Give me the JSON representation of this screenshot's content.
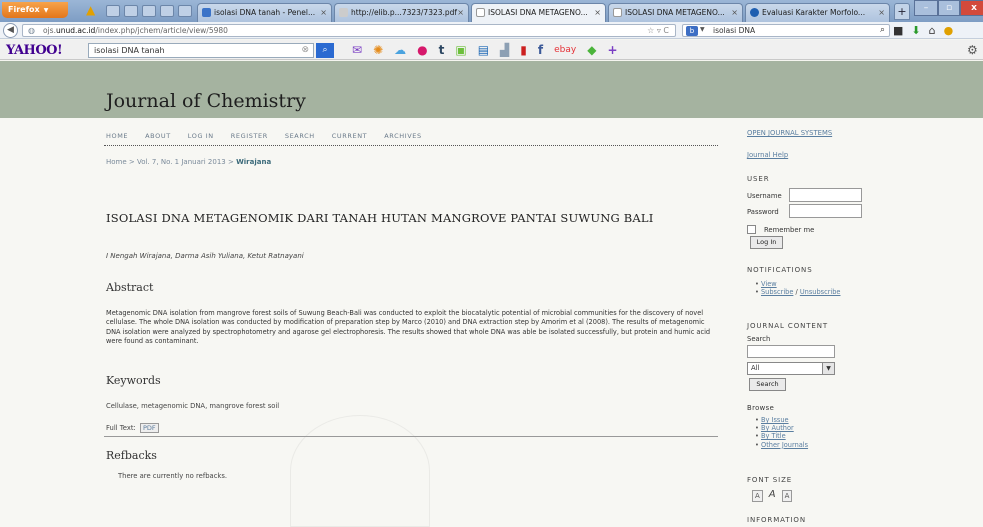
{
  "browser": {
    "firefox_label": "Firefox",
    "tabs": [
      {
        "title": "isolasi DNA tanah - Penel...",
        "icon_color": "#3b73c8"
      },
      {
        "title": "http://elib.p...7323/7323.pdf",
        "icon_color": "#cccccc"
      },
      {
        "title": "ISOLASI DNA METAGENO...",
        "icon_color": "#ffffff"
      },
      {
        "title": "ISOLASI DNA METAGENO...",
        "icon_color": "#ffffff"
      },
      {
        "title": "Evaluasi Karakter Morfolo...",
        "icon_color": "#1f5fb0"
      }
    ],
    "url_prefix": "ojs.",
    "url_domain": "unud.ac.id",
    "url_path": "/index.php/jchem/article/view/5980",
    "search_value": "isolasi DNA"
  },
  "yahoo_toolbar": {
    "logo": "YAHOO!",
    "search_value": "isolasi DNA tanah",
    "icons": [
      "mail-icon",
      "pinwheel-icon",
      "weather-icon",
      "flickr-icon",
      "tumblr-icon",
      "messenger-icon",
      "news-icon",
      "finance-icon",
      "bookmark-icon",
      "facebook-icon",
      "ebay-icon",
      "tag-icon",
      "add-icon"
    ]
  },
  "journal": {
    "title": "Journal of Chemistry",
    "nav": [
      "HOME",
      "ABOUT",
      "LOG IN",
      "REGISTER",
      "SEARCH",
      "CURRENT",
      "ARCHIVES"
    ],
    "breadcrumb": {
      "home": "Home",
      "sep1": " > ",
      "issue": "Vol. 7, No. 1 Januari 2013",
      "sep2": " > ",
      "current": "Wirajana"
    }
  },
  "article": {
    "title": "ISOLASI DNA METAGENOMIK DARI TANAH HUTAN MANGROVE PANTAI SUWUNG BALI",
    "authors": "I Nengah Wirajana, Darma Asih Yuliana, Ketut Ratnayani",
    "abstract_heading": "Abstract",
    "abstract": "Metagenomic DNA isolation from mangrove forest soils of Suwung Beach-Bali was conducted to exploit the biocatalytic potential of microbial communities for the discovery of novel cellulase. The whole DNA isolation was conducted by modification of preparation step by Marco (2010) and DNA extraction step by Amorim et al (2008). The results of metagenomic DNA isolation were analyzed by spectrophotometry and agarose gel electrophoresis. The results showed that whole DNA was able be isolated successfully, but protein and humic acid were found as contaminant.",
    "keywords_heading": "Keywords",
    "keywords": "Cellulase, metagenomic DNA, mangrove forest soil",
    "fulltext_label": "Full Text:",
    "pdf_label": "PDF",
    "refbacks_heading": "Refbacks",
    "refbacks_text": "There are currently no refbacks."
  },
  "sidebar": {
    "ojs_link": "OPEN JOURNAL SYSTEMS",
    "help_link": "Journal Help",
    "user_heading": "USER",
    "username_label": "Username",
    "password_label": "Password",
    "remember_label": "Remember me",
    "login_button": "Log In",
    "notifications_heading": "NOTIFICATIONS",
    "notif_view": "View",
    "notif_subscribe": "Subscribe",
    "notif_sep": " / ",
    "notif_unsubscribe": "Unsubscribe",
    "content_heading": "JOURNAL CONTENT",
    "search_label": "Search",
    "search_scope": "All",
    "search_button": "Search",
    "browse_label": "Browse",
    "browse_items": [
      "By Issue",
      "By Author",
      "By Title",
      "Other Journals"
    ],
    "fontsize_heading": "FONT SIZE",
    "information_heading": "INFORMATION"
  }
}
